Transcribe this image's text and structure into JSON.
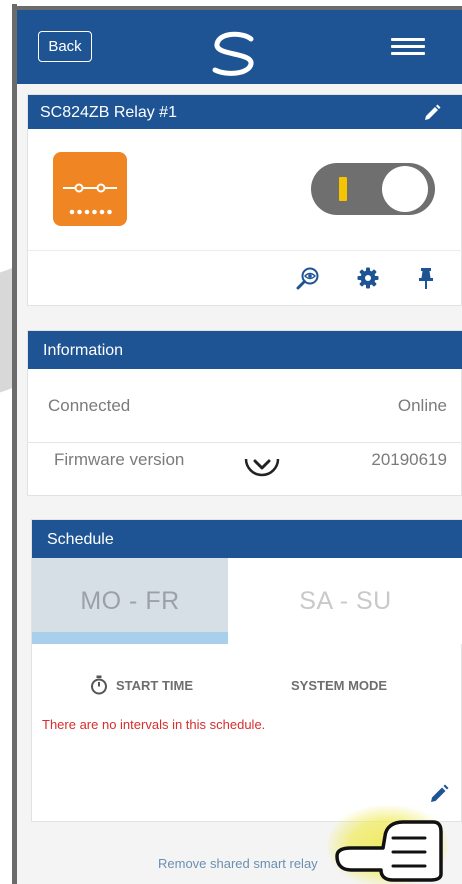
{
  "topbar": {
    "back_label": "Back",
    "logo_icon": "brand-s-logo",
    "menu_icon": "hamburger-menu-icon",
    "color": "#1f5494"
  },
  "device": {
    "title": "SC824ZB Relay #1",
    "edit_icon": "pencil-icon",
    "device_icon": "relay-module-icon",
    "device_icon_color": "#f08524",
    "toggle_state": "on",
    "toggle_accent": "#f4c400",
    "actions": [
      "eye-search-icon",
      "gear-icon",
      "pin-icon"
    ]
  },
  "information": {
    "header": "Information",
    "rows": [
      {
        "label": "Connected",
        "value": "Online"
      },
      {
        "label": "Firmware version",
        "value": "20190619"
      }
    ],
    "expand_icon": "chevron-down-circle-icon"
  },
  "schedule": {
    "header": "Schedule",
    "tabs": [
      {
        "label": "MO - FR",
        "active": true
      },
      {
        "label": "SA - SU",
        "active": false
      }
    ],
    "columns": [
      "START TIME",
      "SYSTEM MODE"
    ],
    "empty_message": "There are no intervals in this schedule.",
    "edit_icon": "pencil-icon"
  },
  "footer": {
    "remove_label": "Remove shared smart relay",
    "pointer_icon": "pointing-hand-icon"
  }
}
